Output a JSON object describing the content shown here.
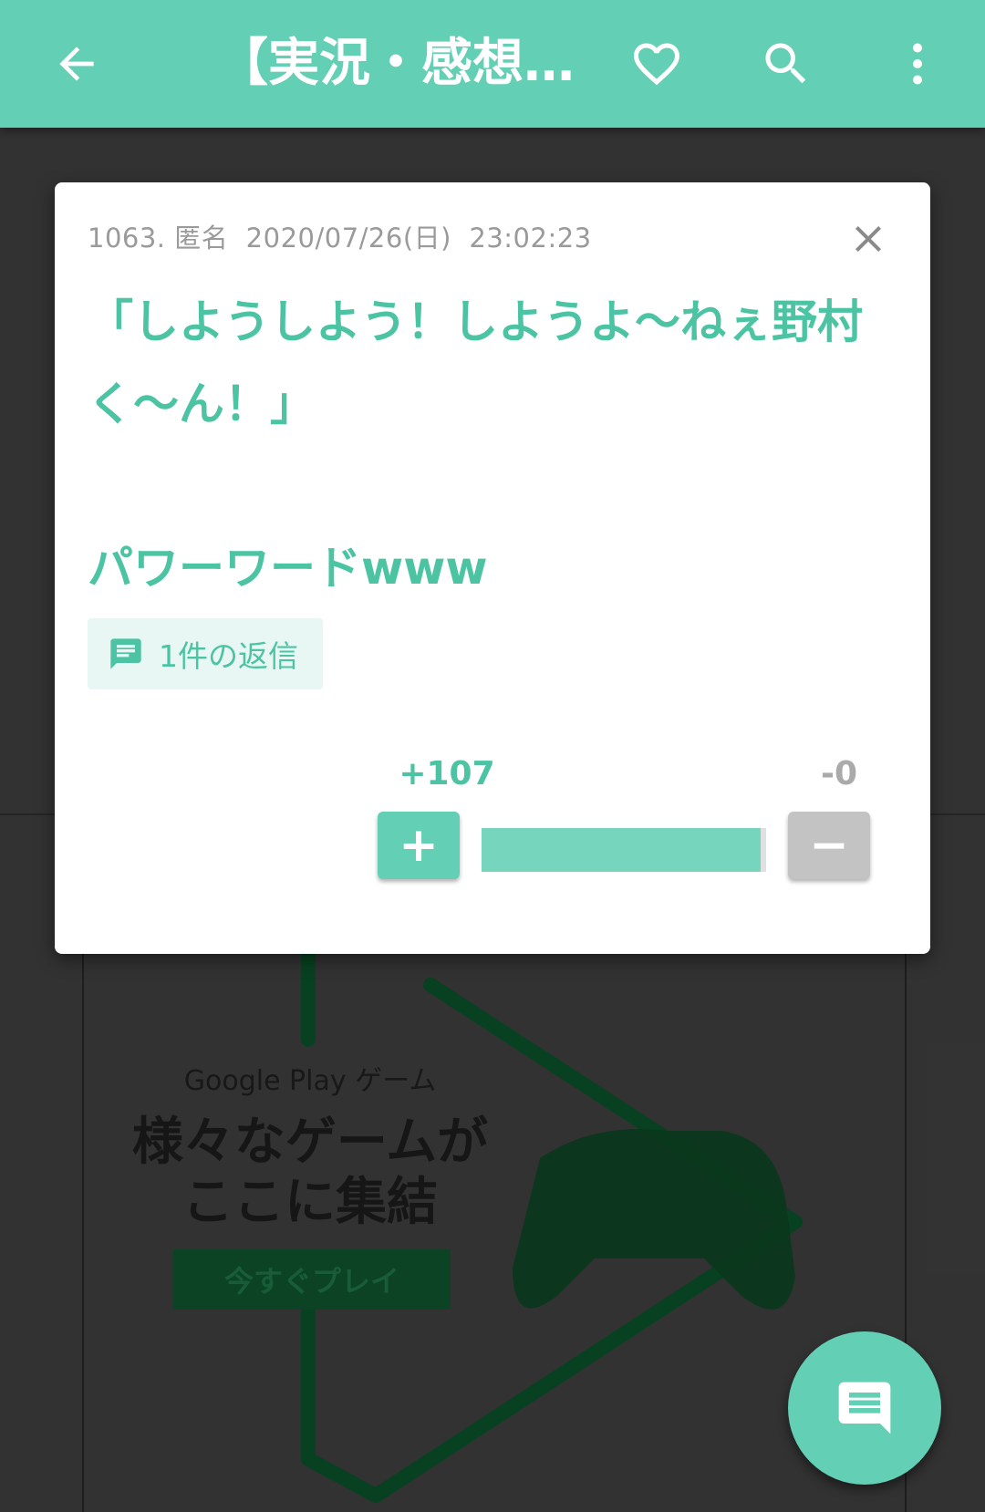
{
  "header": {
    "title": "【実況・感想…",
    "icons": [
      "back-arrow-icon",
      "heart-icon",
      "search-icon",
      "more-vert-icon"
    ]
  },
  "background_ad": {
    "title": "Google Play ゲーム",
    "headline": "様々なゲームが\nここに集結",
    "cta": "今すぐプレイ"
  },
  "popup": {
    "meta": "1063. 匿名  2020/07/26(日)  23:02:23",
    "body": "「しようしよう！しようよ〜ねぇ野村\nく〜ん！」\n\nパワーワードwww",
    "reply_label": "1件の返信",
    "plus_count": "+107",
    "minus_count": "-0",
    "plus_symbol": "+",
    "minus_symbol": "−",
    "vote_ratio": 1.0
  },
  "colors": {
    "accent": "#63cfb4",
    "accent_text": "#4cc4a3",
    "minus_gray": "#c3c3c3"
  }
}
